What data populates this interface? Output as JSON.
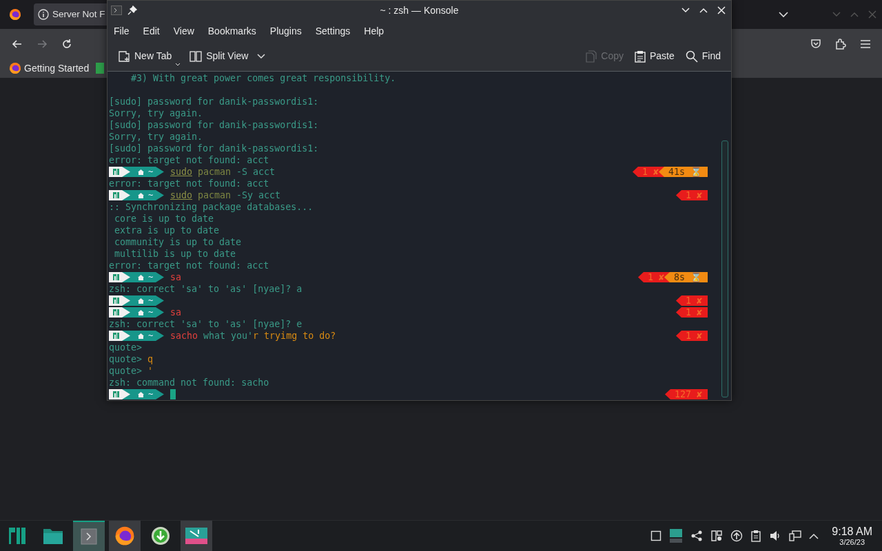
{
  "browser": {
    "tab": {
      "title": "Server Not F"
    },
    "nav": [
      {
        "kind": "back",
        "disabled": false
      },
      {
        "kind": "forward",
        "disabled": true
      },
      {
        "kind": "reload",
        "disabled": false
      }
    ],
    "bookmarks": [
      {
        "label": "Getting Started"
      }
    ]
  },
  "konsole": {
    "title": "~ : zsh — Konsole",
    "menu": [
      "File",
      "Edit",
      "View",
      "Bookmarks",
      "Plugins",
      "Settings",
      "Help"
    ],
    "toolbar_left": [
      {
        "kind": "new-tab",
        "label": "New Tab",
        "disabled": false
      },
      {
        "kind": "split-view",
        "label": "Split View",
        "disabled": false
      }
    ],
    "toolbar_right": [
      {
        "kind": "copy",
        "label": "Copy",
        "disabled": true
      },
      {
        "kind": "paste",
        "label": "Paste",
        "disabled": false
      },
      {
        "kind": "find",
        "label": "Find",
        "disabled": false
      }
    ]
  },
  "terminal": {
    "lines": [
      {
        "kind": "text",
        "segments": [
          {
            "text": "    #3) With great power comes great responsibility.",
            "kind": "plain"
          }
        ]
      },
      {
        "kind": "blank"
      },
      {
        "kind": "text",
        "segments": [
          {
            "text": "[sudo] password for danik-passwordis1:",
            "kind": "plain"
          }
        ]
      },
      {
        "kind": "text",
        "segments": [
          {
            "text": "Sorry, try again.",
            "kind": "plain"
          }
        ]
      },
      {
        "kind": "text",
        "segments": [
          {
            "text": "[sudo] password for danik-passwordis1:",
            "kind": "plain"
          }
        ]
      },
      {
        "kind": "text",
        "segments": [
          {
            "text": "Sorry, try again.",
            "kind": "plain"
          }
        ]
      },
      {
        "kind": "text",
        "segments": [
          {
            "text": "[sudo] password for danik-passwordis1:",
            "kind": "plain"
          }
        ]
      },
      {
        "kind": "text",
        "segments": [
          {
            "text": "error: target not found: acct",
            "kind": "plain"
          }
        ]
      },
      {
        "kind": "prompt",
        "dir": "~",
        "cursor": false,
        "segments": [
          {
            "text": "sudo",
            "kind": "precommand"
          },
          {
            "text": " pacman",
            "kind": "command"
          },
          {
            "text": " -S acct",
            "kind": "arg"
          }
        ],
        "status": [
          {
            "kind": "error",
            "text": "1 ✘"
          },
          {
            "kind": "duration",
            "text": "41s ⌛"
          }
        ]
      },
      {
        "kind": "text",
        "segments": [
          {
            "text": "error: target not found: acct",
            "kind": "plain"
          }
        ]
      },
      {
        "kind": "prompt",
        "dir": "~",
        "cursor": false,
        "segments": [
          {
            "text": "sudo",
            "kind": "precommand"
          },
          {
            "text": " pacman",
            "kind": "command"
          },
          {
            "text": " -Sy acct",
            "kind": "arg"
          }
        ],
        "status": [
          {
            "kind": "error",
            "text": "1 ✘"
          }
        ]
      },
      {
        "kind": "text",
        "segments": [
          {
            "text": ":: Synchronizing package databases...",
            "kind": "plain"
          }
        ]
      },
      {
        "kind": "text",
        "segments": [
          {
            "text": " core is up to date",
            "kind": "plain"
          }
        ]
      },
      {
        "kind": "text",
        "segments": [
          {
            "text": " extra is up to date",
            "kind": "plain"
          }
        ]
      },
      {
        "kind": "text",
        "segments": [
          {
            "text": " community is up to date",
            "kind": "plain"
          }
        ]
      },
      {
        "kind": "text",
        "segments": [
          {
            "text": " multilib is up to date",
            "kind": "plain"
          }
        ]
      },
      {
        "kind": "text",
        "segments": [
          {
            "text": "error: target not found: acct",
            "kind": "plain"
          }
        ]
      },
      {
        "kind": "prompt",
        "dir": "~",
        "cursor": false,
        "segments": [
          {
            "text": "sa",
            "kind": "unknown"
          }
        ],
        "status": [
          {
            "kind": "error",
            "text": "1 ✘"
          },
          {
            "kind": "duration",
            "text": "8s ⌛"
          }
        ]
      },
      {
        "kind": "text",
        "segments": [
          {
            "text": "zsh: correct 'sa' to 'as' [nyae]? a",
            "kind": "plain"
          }
        ]
      },
      {
        "kind": "prompt",
        "dir": "~",
        "cursor": false,
        "status": [
          {
            "kind": "error",
            "text": "1 ✘"
          }
        ]
      },
      {
        "kind": "prompt",
        "dir": "~",
        "cursor": false,
        "segments": [
          {
            "text": "sa",
            "kind": "unknown"
          }
        ],
        "status": [
          {
            "kind": "error",
            "text": "1 ✘"
          }
        ]
      },
      {
        "kind": "text",
        "segments": [
          {
            "text": "zsh: correct 'sa' to 'as' [nyae]? e",
            "kind": "plain"
          }
        ]
      },
      {
        "kind": "prompt",
        "dir": "~",
        "cursor": false,
        "segments": [
          {
            "text": "sacho",
            "kind": "unknown"
          },
          {
            "text": " what you'",
            "kind": "arg"
          },
          {
            "text": "r tryimg to do?",
            "kind": "quoted"
          }
        ],
        "status": [
          {
            "kind": "error",
            "text": "1 ✘"
          }
        ]
      },
      {
        "kind": "text",
        "segments": [
          {
            "text": "quote>",
            "kind": "plain"
          }
        ]
      },
      {
        "kind": "text",
        "segments": [
          {
            "text": "quote>",
            "kind": "plain"
          },
          {
            "text": " q",
            "kind": "quoted"
          }
        ]
      },
      {
        "kind": "text",
        "segments": [
          {
            "text": "quote>",
            "kind": "plain"
          },
          {
            "text": " '",
            "kind": "quoted"
          }
        ]
      },
      {
        "kind": "text",
        "segments": [
          {
            "text": "zsh: command not found: sacho",
            "kind": "plain"
          }
        ]
      },
      {
        "kind": "prompt",
        "dir": "~",
        "cursor": true,
        "status": [
          {
            "kind": "error",
            "text": "127 ✘"
          }
        ]
      }
    ]
  },
  "taskbar": {
    "apps": [
      {
        "kind": "menu",
        "selected": false,
        "running": false
      },
      {
        "kind": "files",
        "selected": false,
        "running": false
      },
      {
        "kind": "terminal",
        "selected": true,
        "running": true
      },
      {
        "kind": "browser",
        "selected": false,
        "running": true
      },
      {
        "kind": "download",
        "selected": false,
        "running": false
      },
      {
        "kind": "editor",
        "selected": false,
        "running": true
      }
    ],
    "clock": {
      "time": "9:18 AM",
      "date": "3/26/23"
    }
  }
}
